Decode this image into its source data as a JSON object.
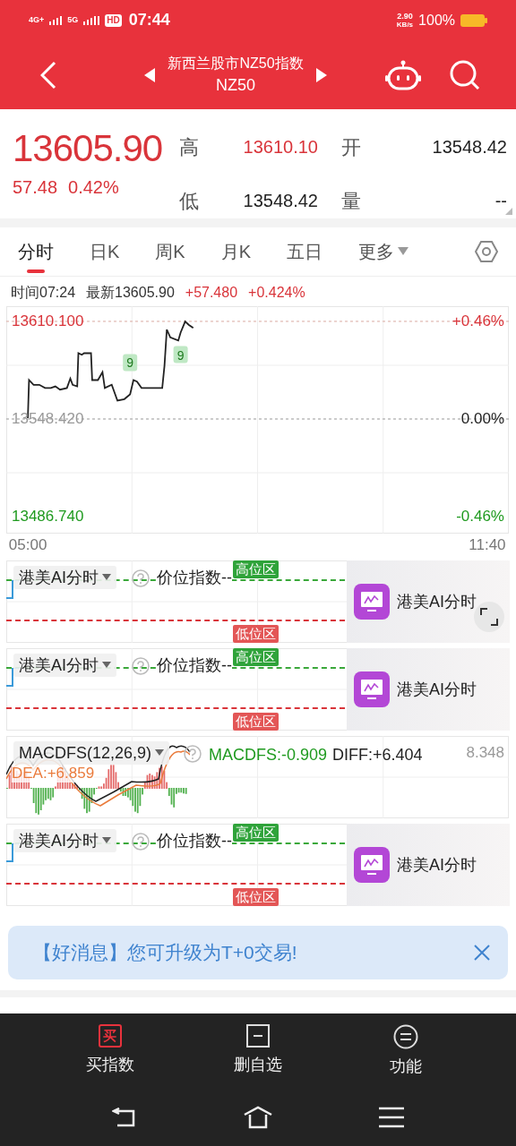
{
  "status_bar": {
    "network_1": "4G+",
    "network_2": "5G",
    "hd": "HD",
    "time": "07:44",
    "speed": "2.90",
    "speed_unit": "KB/s",
    "battery": "100%"
  },
  "header": {
    "title": "新西兰股市NZ50指数",
    "subtitle": "NZ50"
  },
  "quote": {
    "price": "13605.90",
    "change": "57.48",
    "change_pct": "0.42%",
    "stats": [
      {
        "label": "高",
        "value": "13610.10",
        "kind": "up"
      },
      {
        "label": "开",
        "value": "13548.42",
        "kind": "flat"
      },
      {
        "label": "低",
        "value": "13548.42",
        "kind": "flat"
      },
      {
        "label": "量",
        "value": "--",
        "kind": "flat"
      }
    ]
  },
  "tabs": [
    {
      "label": "分时",
      "selected": true,
      "kind": "tab"
    },
    {
      "label": "日K",
      "selected": false,
      "kind": "tab"
    },
    {
      "label": "周K",
      "selected": false,
      "kind": "tab"
    },
    {
      "label": "月K",
      "selected": false,
      "kind": "tab"
    },
    {
      "label": "五日",
      "selected": false,
      "kind": "tab"
    },
    {
      "label": "更多",
      "selected": false,
      "kind": "menu"
    }
  ],
  "info_line": {
    "time_label": "时间",
    "time": "07:24",
    "latest_label": "最新",
    "latest": "13605.90",
    "change": "+57.480",
    "change_pct": "+0.424%"
  },
  "price_chart": {
    "right_labels": [
      {
        "text": "+0.46%",
        "kind": "up"
      },
      {
        "text": "0.00%",
        "kind": "flat"
      },
      {
        "text": "-0.46%",
        "kind": "down"
      }
    ],
    "chart_data": {
      "type": "line",
      "xlim": [
        4.7,
        11.9667
      ],
      "ylim": [
        13476,
        13619.7
      ],
      "xticks": [
        {
          "value": 5,
          "label": "05:00"
        },
        {
          "value": 11.6667,
          "label": "11:40"
        }
      ],
      "yticks": [
        {
          "value": 13610.1,
          "label": "13610.100"
        },
        {
          "value": 13548.42,
          "label": "13548.420"
        },
        {
          "value": 13486.74,
          "label": "13486.740"
        }
      ],
      "x": [
        5,
        5.0167,
        5.0833,
        5.1667,
        5.25,
        5.3333,
        5.4,
        5.4667,
        5.5667,
        5.6167,
        5.65,
        5.7167,
        5.7333,
        5.7833,
        5.8167,
        5.9167,
        5.9333,
        6.0167,
        6.0833,
        6.1167,
        6.2167,
        6.3,
        6.4,
        6.4833,
        6.5333,
        6.5833,
        6.65,
        6.95,
        6.9833,
        7.0167,
        7.0667,
        7.1833,
        7.2167,
        7.2833,
        7.3333,
        7.4
      ],
      "series": [
        {
          "color": "#222222",
          "values": [
            13549,
            13573,
            13570,
            13570,
            13568,
            13568,
            13569,
            13567,
            13568,
            13574,
            13570,
            13569,
            13590,
            13589,
            13590,
            13590,
            13573,
            13573,
            13578,
            13568,
            13570,
            13560,
            13561,
            13564,
            13573,
            13572,
            13568,
            13568,
            13582,
            13605,
            13600,
            13598,
            13603,
            13610,
            13608,
            13606
          ]
        }
      ],
      "ref_lines": [
        {
          "axis": "y",
          "value": 13610.1,
          "color": "#d9a9a0"
        },
        {
          "axis": "y",
          "value": 13548.42,
          "color": "#999999"
        }
      ],
      "annotations": [
        {
          "x": 6.4833,
          "y": 13564,
          "text": "9"
        },
        {
          "x": 7.2167,
          "y": 13603,
          "text": "9"
        }
      ]
    }
  },
  "indicators": [
    {
      "kind": "ai",
      "selector": "港美AI分时",
      "name": "价位指数--",
      "high_tag": "高位区",
      "low_tag": "低位区",
      "promo": "港美AI分时",
      "expand": true
    },
    {
      "kind": "ai",
      "selector": "港美AI分时",
      "name": "价位指数--",
      "high_tag": "高位区",
      "low_tag": "低位区",
      "promo": "港美AI分时",
      "expand": false
    },
    {
      "kind": "macd",
      "selector": "MACDFS(12,26,9)",
      "values": [
        {
          "text": "MACDFS:-0.909",
          "kind": "down"
        },
        {
          "text": "DIFF:+6.404",
          "kind": "flat"
        }
      ],
      "dea": "DEA:+6.859",
      "max": "8.348"
    },
    {
      "kind": "ai",
      "selector": "港美AI分时",
      "name": "价位指数--",
      "high_tag": "高位区",
      "low_tag": "低位区",
      "promo": "港美AI分时",
      "expand": false
    }
  ],
  "banner": {
    "text": "【好消息】您可升级为T+0交易!"
  },
  "bottom_nav": [
    {
      "kind": "boxed_char",
      "icon_text": "买",
      "label": "买指数"
    },
    {
      "kind": "minus_box",
      "label": "删自选"
    },
    {
      "kind": "circle_lines",
      "label": "功能"
    }
  ]
}
